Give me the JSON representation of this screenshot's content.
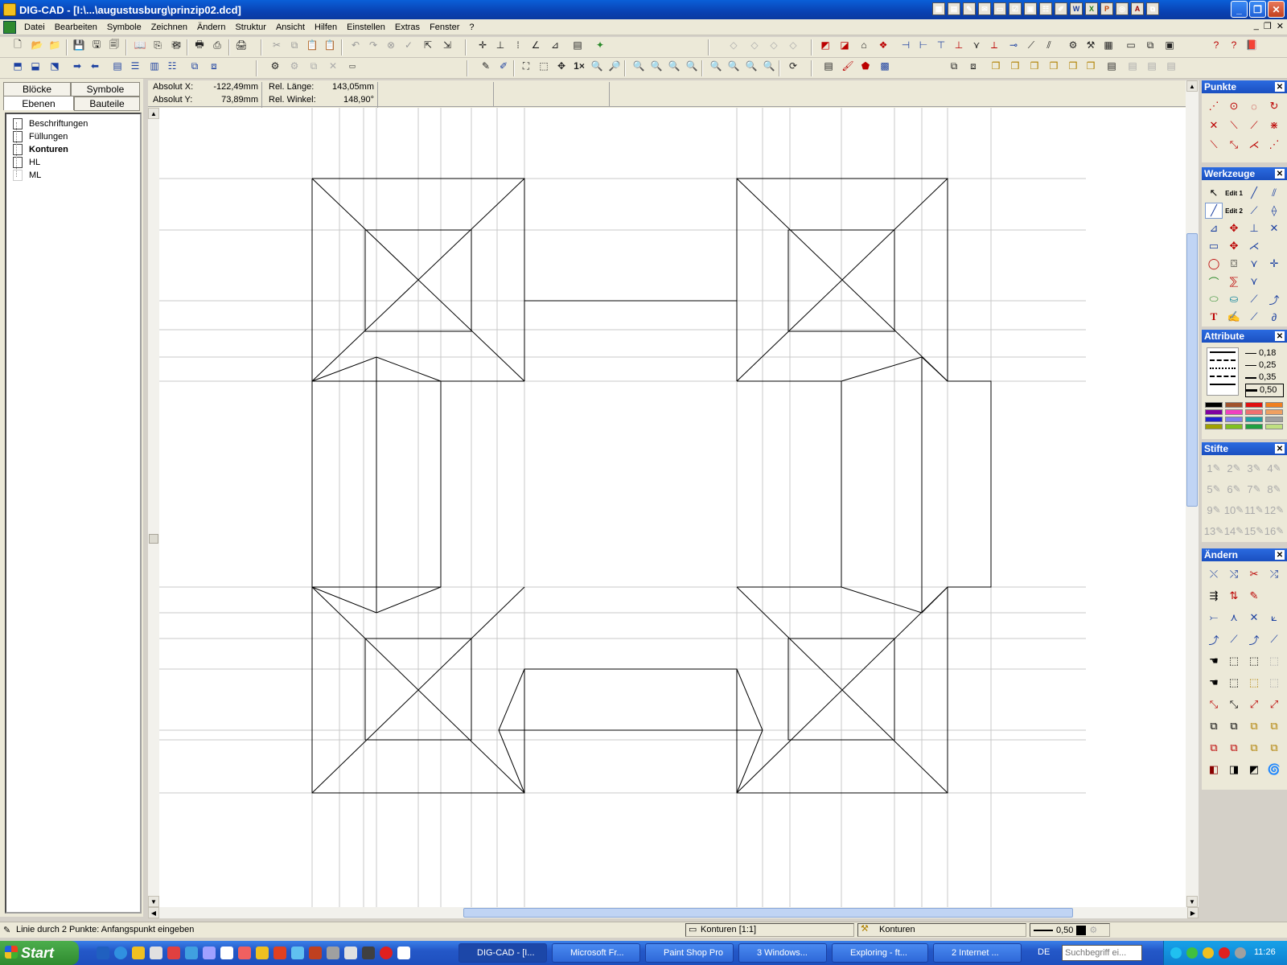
{
  "window": {
    "title": "DIG-CAD - [I:\\...\\augustusburg\\prinzip02.dcd]",
    "min_label": "_",
    "max_label": "❐",
    "close_label": "✕"
  },
  "menu": [
    "Datei",
    "Bearbeiten",
    "Symbole",
    "Zeichnen",
    "Ändern",
    "Struktur",
    "Ansicht",
    "Hilfen",
    "Einstellen",
    "Extras",
    "Fenster",
    "?"
  ],
  "left_panel": {
    "tabs_row1": [
      "Blöcke",
      "Symbole"
    ],
    "tabs_row2": [
      "Ebenen",
      "Bauteile"
    ],
    "active_tab": "Ebenen",
    "layers": [
      {
        "name": "Beschriftungen",
        "bold": false
      },
      {
        "name": "Füllungen",
        "bold": false
      },
      {
        "name": "Konturen",
        "bold": true
      },
      {
        "name": "HL",
        "bold": false
      },
      {
        "name": "ML",
        "bold": false
      }
    ]
  },
  "coords": {
    "abs_x_label": "Absolut X:",
    "abs_x_value": "-122,49mm",
    "abs_y_label": "Absolut Y:",
    "abs_y_value": "73,89mm",
    "rel_len_label": "Rel. Länge:",
    "rel_len_value": "143,05mm",
    "rel_ang_label": "Rel. Winkel:",
    "rel_ang_value": "148,90°"
  },
  "palettes": {
    "punkte": "Punkte",
    "werkzeuge": "Werkzeuge",
    "attribute": "Attribute",
    "stifte": "Stifte",
    "aendern": "Ändern",
    "line_widths": [
      "0,18",
      "0,25",
      "0,35",
      "0,50"
    ],
    "colors": [
      "#000000",
      "#a0522d",
      "#e01010",
      "#f08020",
      "#8000a0",
      "#f040c0",
      "#f07070",
      "#f0a060",
      "#2020d0",
      "#8080f0",
      "#20a0a0",
      "#a0a0a0",
      "#a0a000",
      "#80c020",
      "#20a040",
      "#c0e080"
    ],
    "pen_labels": [
      "1",
      "2",
      "3",
      "4",
      "5",
      "6",
      "7",
      "8",
      "9",
      "10",
      "11",
      "12",
      "13",
      "14",
      "15",
      "16"
    ],
    "edit1": "Edit 1",
    "edit2": "Edit 2",
    "text_tool": "T"
  },
  "statusbar": {
    "prompt": "Linie durch 2 Punkte: Anfangspunkt eingeben",
    "layer_scale": "Konturen [1:1]",
    "layer": "Konturen",
    "linewidth": "0,50"
  },
  "taskbar": {
    "start": "Start",
    "tasks": [
      "DIG-CAD - [I...",
      "Microsoft Fr...",
      "Paint Shop Pro",
      "3 Windows...",
      "Exploring - ft...",
      "2 Internet ..."
    ],
    "lang": "DE",
    "search_placeholder": "Suchbegriff ei...",
    "clock": "11:26"
  },
  "toolbar": {
    "zoom_1x": "1×"
  }
}
